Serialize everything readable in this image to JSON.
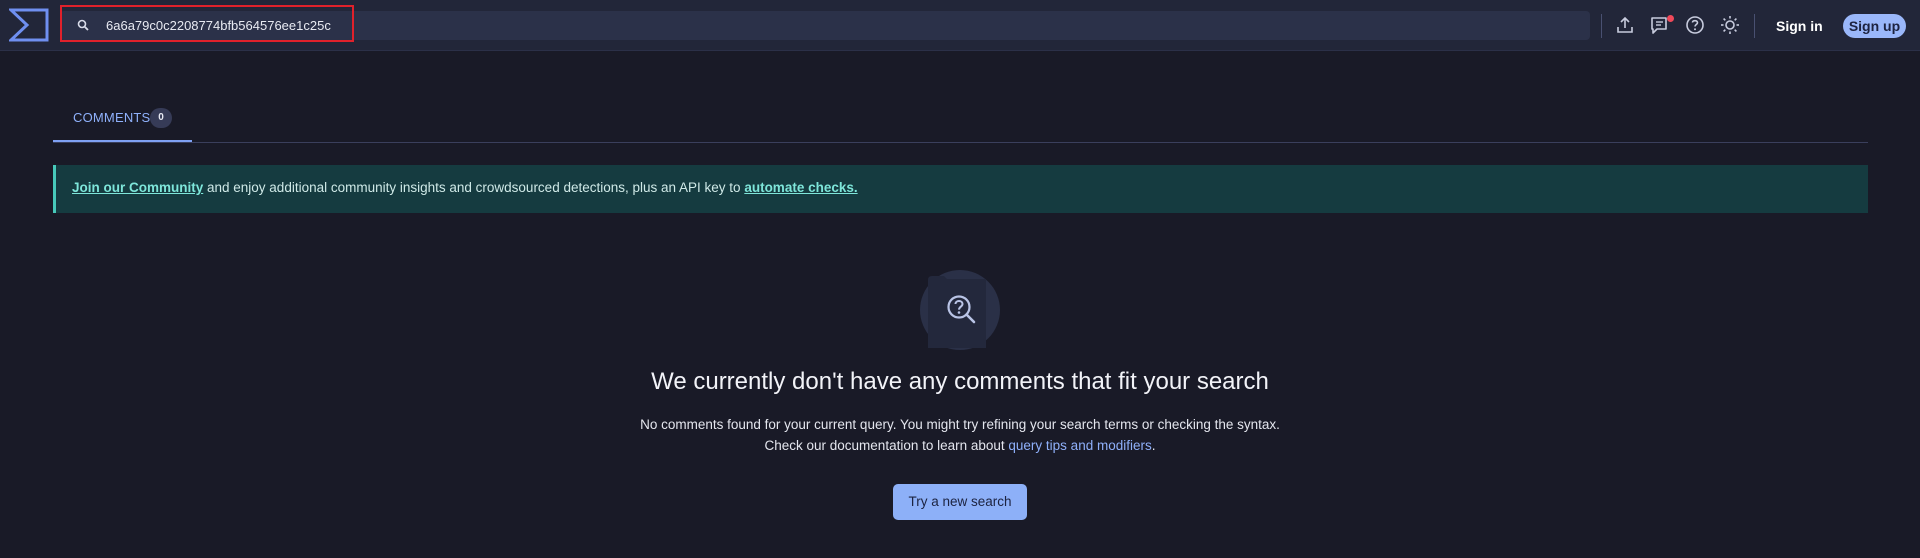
{
  "header": {
    "logo_icon": "virustotal-sigma-logo",
    "search": {
      "value": "6a6a79c0c2208774bfb564576ee1c25c",
      "placeholder": ""
    },
    "icons": [
      "upload-icon",
      "chat-icon",
      "help-icon",
      "theme-icon"
    ],
    "signin_label": "Sign in",
    "signup_label": "Sign up"
  },
  "tabs": [
    {
      "label": "COMMENTS",
      "count": "0"
    }
  ],
  "banner": {
    "link1": "Join our Community",
    "text": " and enjoy additional community insights and crowdsourced detections, plus an API key to ",
    "link2": "automate checks."
  },
  "empty_state": {
    "icon": "search-question-icon",
    "title": "We currently don't have any comments that fit your search",
    "line1": "No comments found for your current query. You might try refining your search terms or checking the syntax.",
    "line2_prefix": "Check our documentation to learn about ",
    "line2_link": "query tips and modifiers",
    "line2_suffix": ".",
    "button_label": "Try a new search"
  },
  "colors": {
    "background": "#191a27",
    "topbar": "#222639",
    "accent": "#8db0f8",
    "banner": "#153b40",
    "highlight": "#e0212b"
  }
}
